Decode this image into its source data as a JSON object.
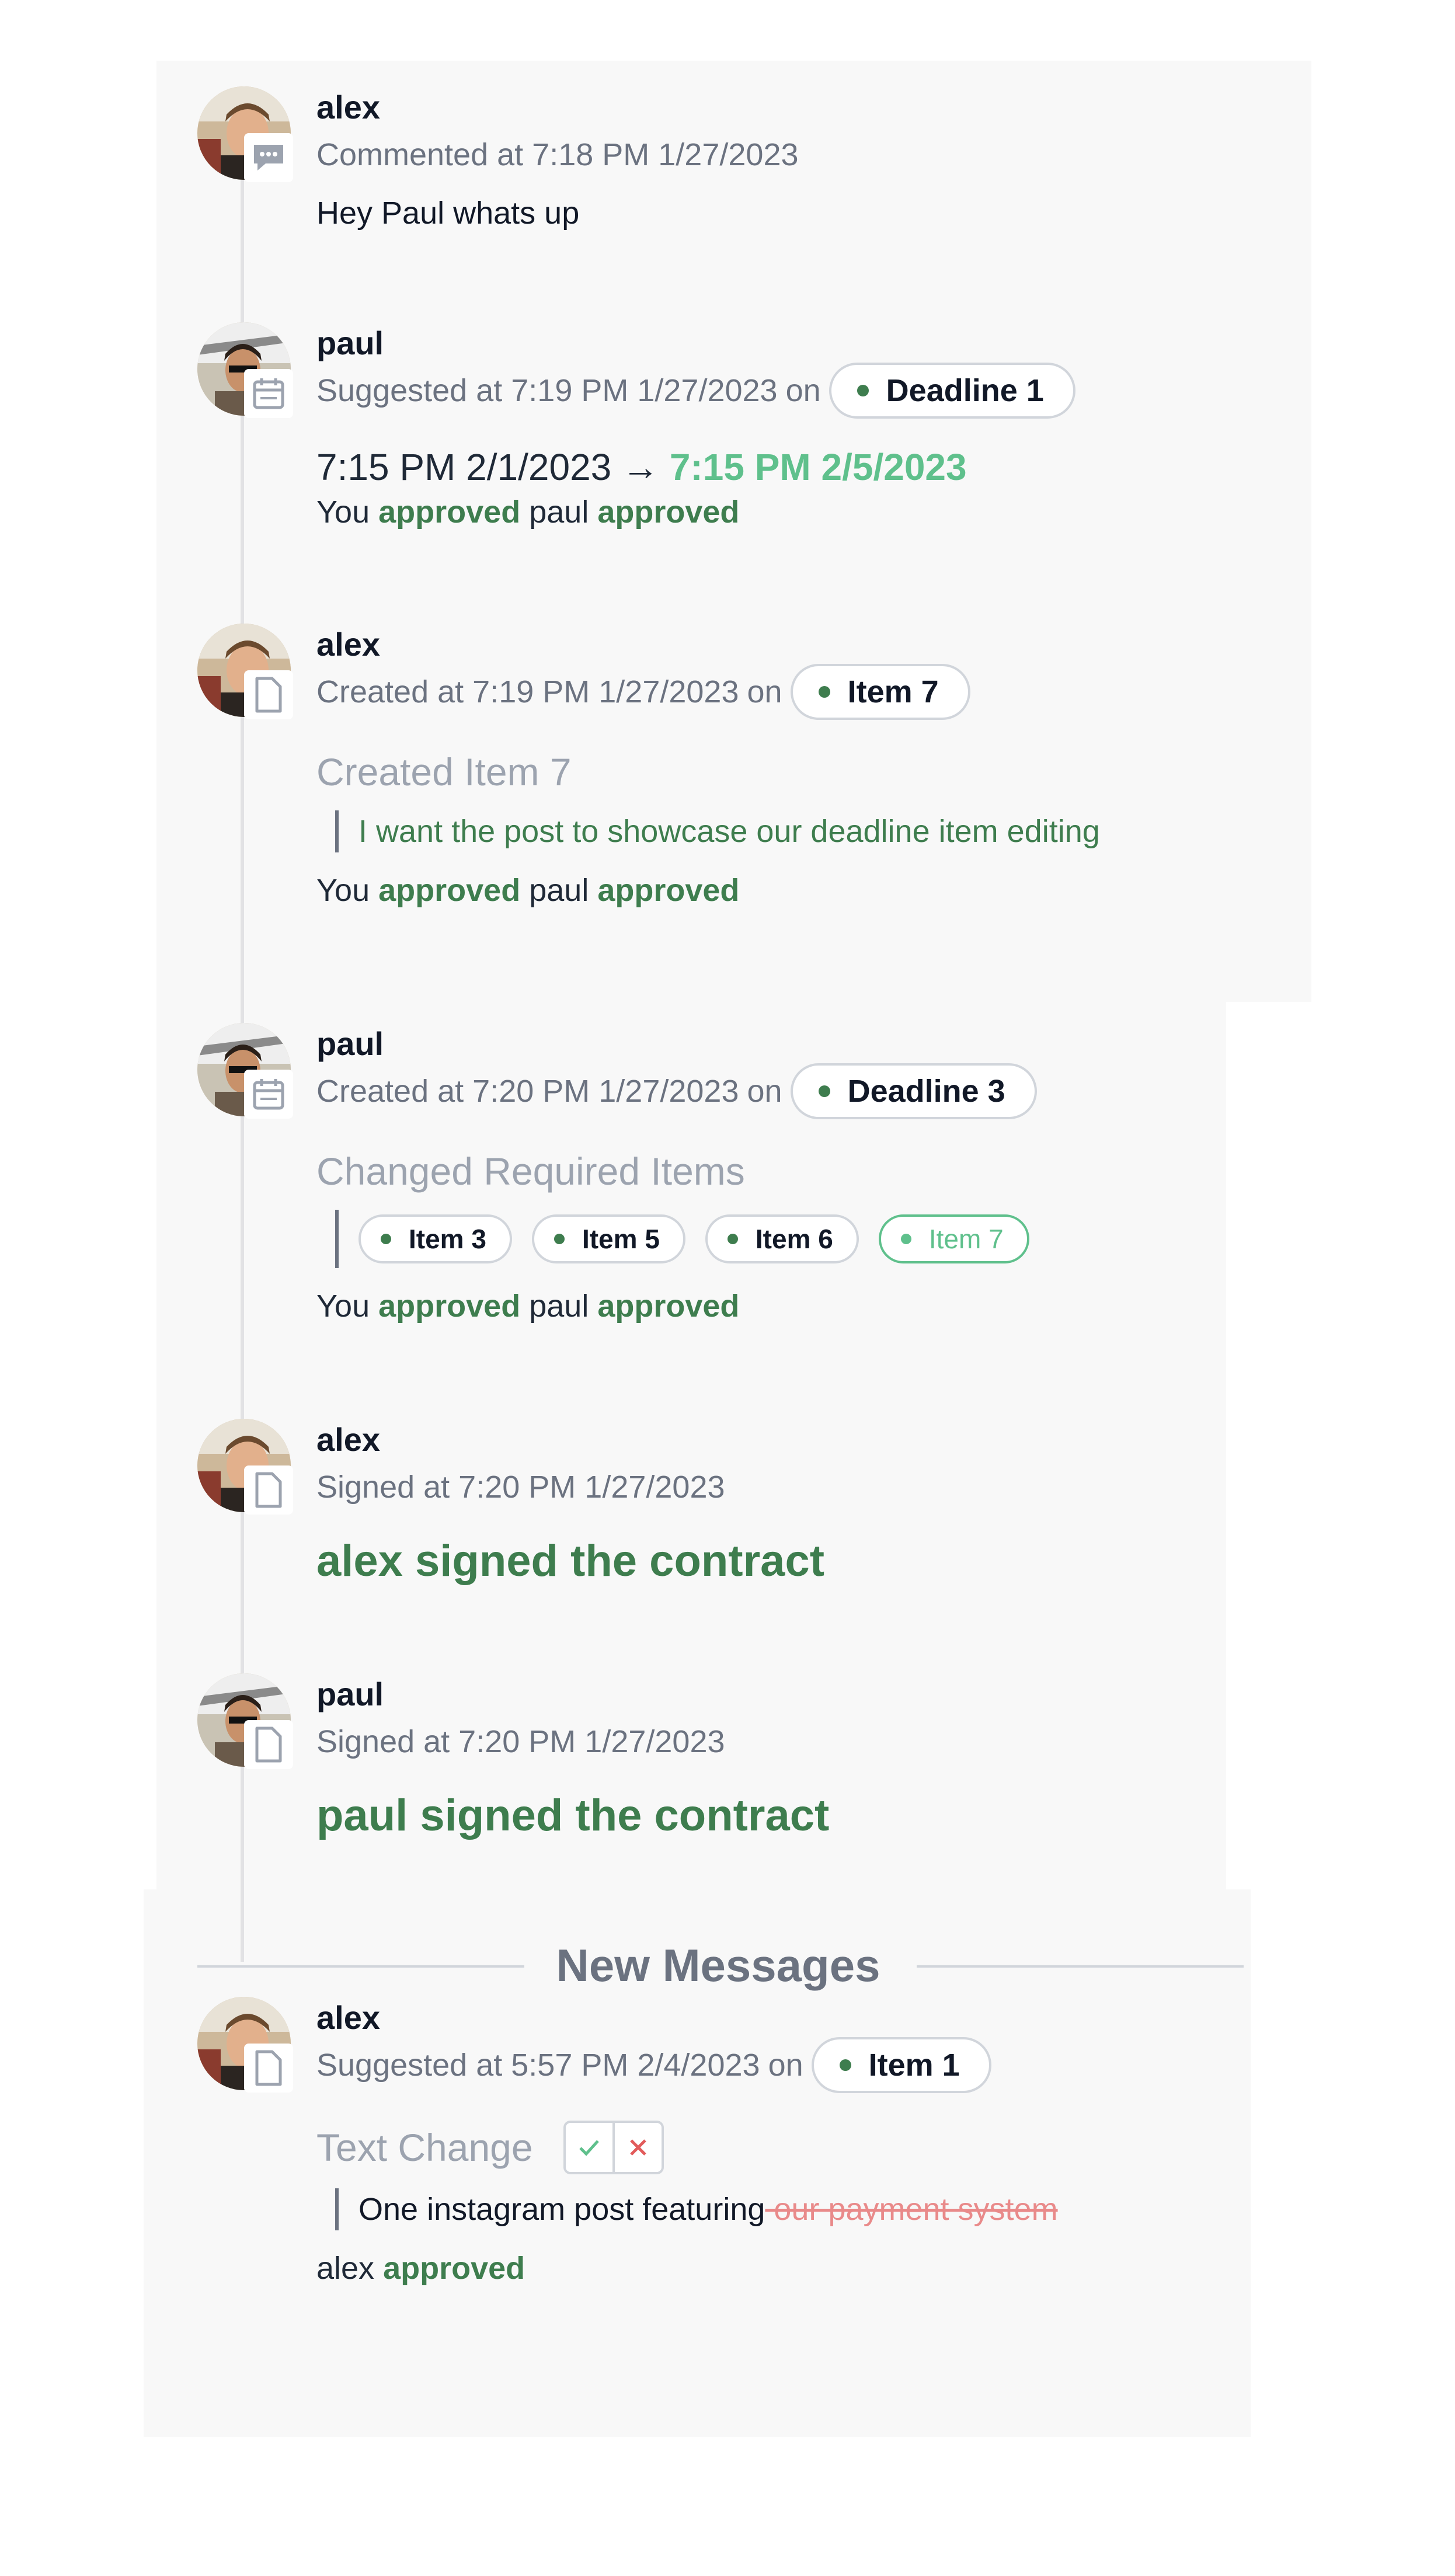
{
  "entries": [
    {
      "user": "alex",
      "action": "Commented at 7:18 PM 1/27/2023",
      "icon": "comment-icon",
      "body": "Hey Paul whats up"
    },
    {
      "user": "paul",
      "action": "Suggested at 7:19 PM 1/27/2023",
      "on": "on",
      "pill": "Deadline 1",
      "icon": "calendar-icon",
      "old_value": "7:15 PM 2/1/2023",
      "arrow": "→",
      "new_value": "7:15 PM 2/5/2023",
      "approvals": {
        "you": "You",
        "you_status": "approved",
        "other": "paul",
        "other_status": "approved"
      }
    },
    {
      "user": "alex",
      "action": "Created at 7:19 PM 1/27/2023",
      "on": "on",
      "pill": "Item 7",
      "icon": "document-icon",
      "title": "Created Item 7",
      "quote": "I want the post to showcase our deadline item editing",
      "approvals": {
        "you": "You",
        "you_status": "approved",
        "other": "paul",
        "other_status": "approved"
      }
    },
    {
      "user": "paul",
      "action": "Created at 7:20 PM 1/27/2023",
      "on": "on",
      "pill": "Deadline 3",
      "icon": "calendar-icon",
      "title": "Changed Required Items",
      "items": [
        "Item 3",
        "Item 5",
        "Item 6",
        "Item 7"
      ],
      "approvals": {
        "you": "You",
        "you_status": "approved",
        "other": "paul",
        "other_status": "approved"
      }
    },
    {
      "user": "alex",
      "action": "Signed at 7:20 PM 1/27/2023",
      "icon": "document-icon",
      "signed": "alex signed the contract"
    },
    {
      "user": "paul",
      "action": "Signed at 7:20 PM 1/27/2023",
      "icon": "document-icon",
      "signed": "paul signed the contract"
    }
  ],
  "divider": "New Messages",
  "new_entry": {
    "user": "alex",
    "action": "Suggested at 5:57 PM 2/4/2023",
    "on": "on",
    "pill": "Item 1",
    "icon": "document-icon",
    "title": "Text Change",
    "quote_text": "One instagram post featuring",
    "quote_removed": " our payment system",
    "approvals": {
      "other": "alex",
      "other_status": "approved"
    }
  },
  "colors": {
    "approved_green": "#3e7d4e",
    "new_value_green": "#5fc08c",
    "removed_red": "#e98a8a",
    "muted_gray": "#6b7280"
  }
}
